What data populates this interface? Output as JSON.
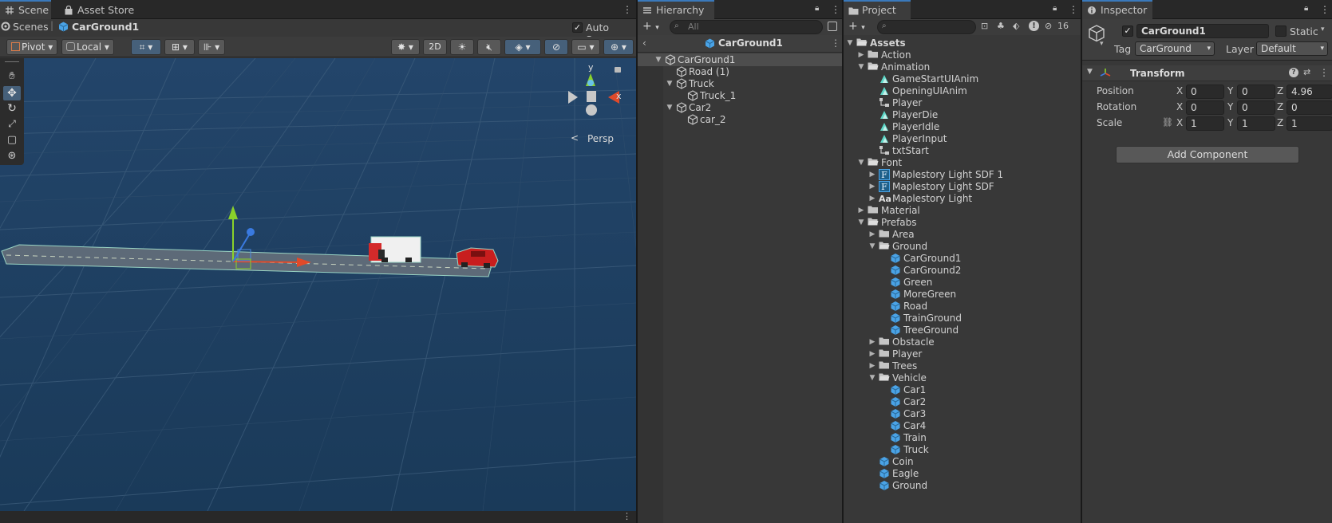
{
  "scene_panel": {
    "tabs": [
      {
        "label": "Scene"
      },
      {
        "label": "Asset Store"
      }
    ],
    "breadcrumb": {
      "root": "Scenes",
      "current": "CarGround1"
    },
    "autosave": {
      "label": "Auto Save",
      "checked": true
    },
    "toolbar": {
      "pivot": "Pivot",
      "local": "Local",
      "mode_2d": "2D"
    },
    "gizmo": {
      "y_label": "y",
      "x_label": "x",
      "persp_label": "Persp"
    },
    "tools": [
      "hand",
      "move",
      "rotate",
      "scale",
      "rect",
      "transform"
    ]
  },
  "hierarchy": {
    "tab": "Hierarchy",
    "search_placeholder": "All",
    "scene_name": "CarGround1",
    "items": [
      {
        "label": "CarGround1",
        "depth": 0,
        "expanded": true,
        "selected": true
      },
      {
        "label": "Road (1)",
        "depth": 1,
        "expanded": null
      },
      {
        "label": "Truck",
        "depth": 1,
        "expanded": true
      },
      {
        "label": "Truck_1",
        "depth": 2,
        "expanded": null
      },
      {
        "label": "Car2",
        "depth": 1,
        "expanded": true
      },
      {
        "label": "car_2",
        "depth": 2,
        "expanded": null
      }
    ]
  },
  "project": {
    "tab": "Project",
    "hidden_count": "16",
    "items": [
      {
        "label": "Assets",
        "depth": 0,
        "type": "folder",
        "expanded": true,
        "bold": true
      },
      {
        "label": "Action",
        "depth": 1,
        "type": "folder",
        "expanded": false
      },
      {
        "label": "Animation",
        "depth": 1,
        "type": "folder",
        "expanded": true
      },
      {
        "label": "GameStartUIAnim",
        "depth": 2,
        "type": "anim"
      },
      {
        "label": "OpeningUIAnim",
        "depth": 2,
        "type": "anim"
      },
      {
        "label": "Player",
        "depth": 2,
        "type": "controller"
      },
      {
        "label": "PlayerDie",
        "depth": 2,
        "type": "anim"
      },
      {
        "label": "PlayerIdle",
        "depth": 2,
        "type": "anim"
      },
      {
        "label": "PlayerInput",
        "depth": 2,
        "type": "anim"
      },
      {
        "label": "txtStart",
        "depth": 2,
        "type": "controller"
      },
      {
        "label": "Font",
        "depth": 1,
        "type": "folder",
        "expanded": true
      },
      {
        "label": "Maplestory Light SDF 1",
        "depth": 2,
        "type": "fontasset",
        "expanded": false
      },
      {
        "label": "Maplestory Light SDF",
        "depth": 2,
        "type": "fontasset",
        "expanded": false
      },
      {
        "label": "Maplestory Light",
        "depth": 2,
        "type": "font",
        "expanded": false
      },
      {
        "label": "Material",
        "depth": 1,
        "type": "folder",
        "expanded": false
      },
      {
        "label": "Prefabs",
        "depth": 1,
        "type": "folder",
        "expanded": true
      },
      {
        "label": "Area",
        "depth": 2,
        "type": "folder",
        "expanded": false
      },
      {
        "label": "Ground",
        "depth": 2,
        "type": "folder",
        "expanded": true
      },
      {
        "label": "CarGround1",
        "depth": 3,
        "type": "prefab"
      },
      {
        "label": "CarGround2",
        "depth": 3,
        "type": "prefab"
      },
      {
        "label": "Green",
        "depth": 3,
        "type": "prefab"
      },
      {
        "label": "MoreGreen",
        "depth": 3,
        "type": "prefab"
      },
      {
        "label": "Road",
        "depth": 3,
        "type": "prefab"
      },
      {
        "label": "TrainGround",
        "depth": 3,
        "type": "prefab"
      },
      {
        "label": "TreeGround",
        "depth": 3,
        "type": "prefab"
      },
      {
        "label": "Obstacle",
        "depth": 2,
        "type": "folder",
        "expanded": false
      },
      {
        "label": "Player",
        "depth": 2,
        "type": "folder",
        "expanded": false
      },
      {
        "label": "Trees",
        "depth": 2,
        "type": "folder",
        "expanded": false
      },
      {
        "label": "Vehicle",
        "depth": 2,
        "type": "folder",
        "expanded": true
      },
      {
        "label": "Car1",
        "depth": 3,
        "type": "prefab"
      },
      {
        "label": "Car2",
        "depth": 3,
        "type": "prefab"
      },
      {
        "label": "Car3",
        "depth": 3,
        "type": "prefab"
      },
      {
        "label": "Car4",
        "depth": 3,
        "type": "prefab"
      },
      {
        "label": "Train",
        "depth": 3,
        "type": "prefab"
      },
      {
        "label": "Truck",
        "depth": 3,
        "type": "prefab"
      },
      {
        "label": "Coin",
        "depth": 2,
        "type": "prefab"
      },
      {
        "label": "Eagle",
        "depth": 2,
        "type": "prefab"
      },
      {
        "label": "Ground",
        "depth": 2,
        "type": "prefab"
      }
    ]
  },
  "inspector": {
    "tab": "Inspector",
    "object_name": "CarGround1",
    "active": true,
    "static_label": "Static",
    "tag_label": "Tag",
    "tag_value": "CarGround",
    "layer_label": "Layer",
    "layer_value": "Default",
    "transform": {
      "title": "Transform",
      "rows": [
        {
          "label": "Position",
          "x": "0",
          "y": "0",
          "z": "4.96"
        },
        {
          "label": "Rotation",
          "x": "0",
          "y": "0",
          "z": "0"
        },
        {
          "label": "Scale",
          "x": "1",
          "y": "1",
          "z": "1"
        }
      ],
      "axis_x": "X",
      "axis_y": "Y",
      "axis_z": "Z"
    },
    "add_component": "Add Component"
  },
  "colors": {
    "accent": "#3a79bb",
    "sky": "#1d3d5d",
    "selection": "#4d4d4d",
    "prefab": "#4aa3e6"
  }
}
